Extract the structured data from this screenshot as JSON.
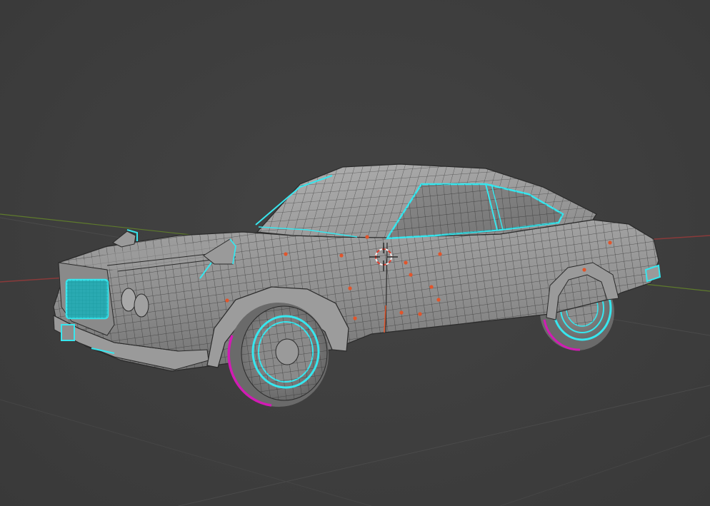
{
  "viewport": {
    "mode": "edit",
    "shading": "solid",
    "object": "car",
    "colors": {
      "background": "#3d3d3d",
      "mesh_face": "#8e8e8e",
      "mesh_wire": "#2e2e2e",
      "selected_edge": "#37e6ee",
      "seam_edge": "#d21bb4",
      "axis_x": "#8a3a3a",
      "axis_y": "#5e7a2c",
      "grid": "#4a4a4a",
      "vertex_marker": "#e2552b",
      "cursor_red": "#e23b2b",
      "cursor_white": "#f2f2f2"
    },
    "icons": [
      "3d-cursor-icon"
    ]
  }
}
